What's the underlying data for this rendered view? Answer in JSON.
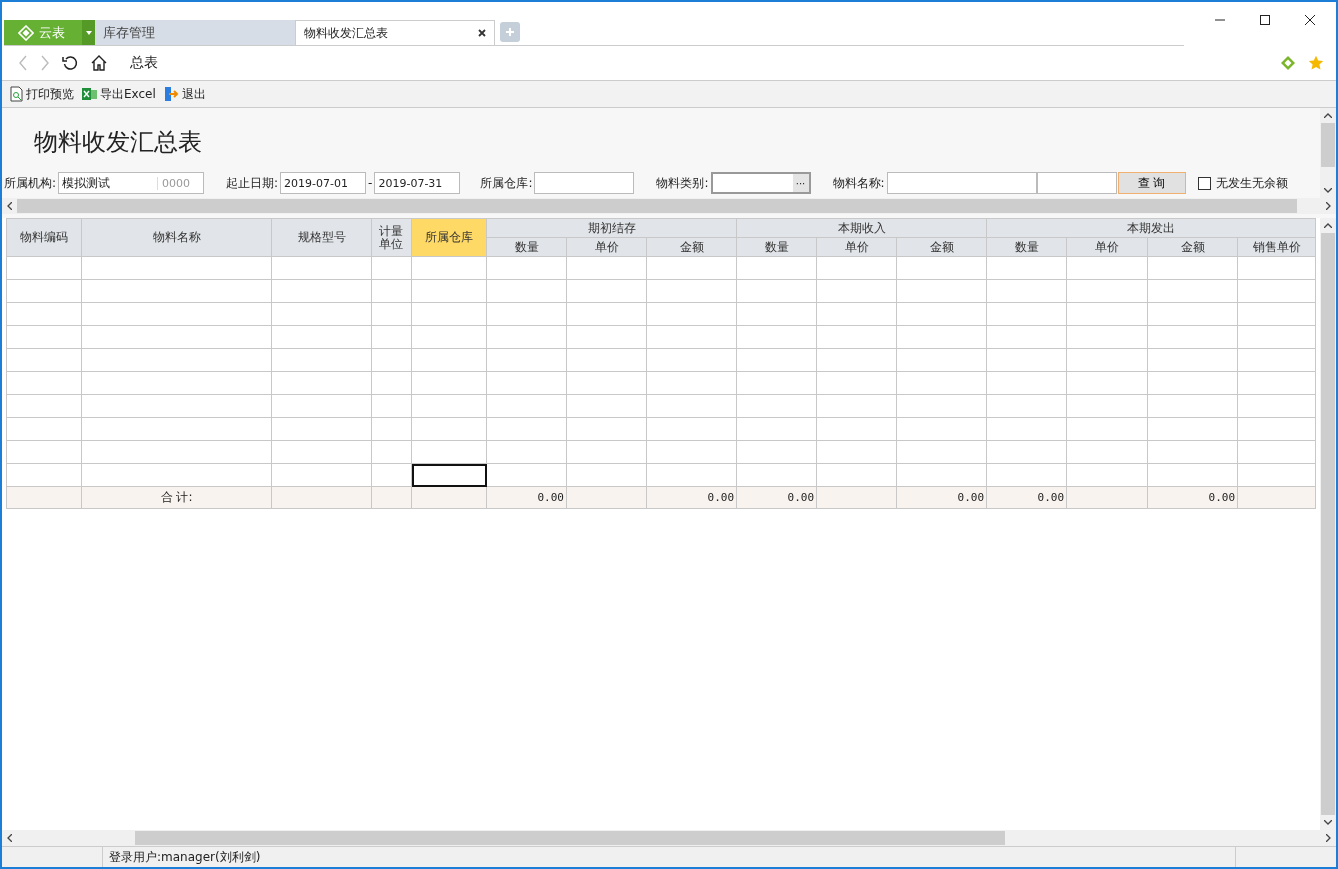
{
  "browser": {
    "brand_tab": "云表",
    "tabs": [
      {
        "label": "库存管理",
        "selected": false
      },
      {
        "label": "物料收发汇总表",
        "selected": true
      }
    ],
    "address": "总表"
  },
  "toolbar": [
    "打印预览",
    "导出Excel",
    "退出"
  ],
  "report_title": "物料收发汇总表",
  "filters": [
    {
      "kind": "text",
      "label": "所属机构:",
      "value": "模拟测试",
      "code": "0000"
    },
    {
      "kind": "range",
      "label": "起止日期:",
      "from": "2019-07-01",
      "separator": "-",
      "to": "2019-07-31"
    },
    {
      "kind": "text",
      "label": "所属仓库:"
    },
    {
      "kind": "picker",
      "label": "物料类别:",
      "button": "···"
    },
    {
      "kind": "double",
      "label": "物料名称:"
    }
  ],
  "query_button": "查  询",
  "checkbox": {
    "label": "无发生无余额",
    "checked": false
  },
  "table": {
    "columns": [
      {
        "label": "物料编码",
        "selected": false
      },
      {
        "label": "物料名称",
        "selected": false
      },
      {
        "label": "规格型号",
        "selected": false
      },
      {
        "label": "计量单位",
        "selected": false
      },
      {
        "label": "所属仓库",
        "selected": true
      },
      {
        "label": "期初结存",
        "children": [
          "数量",
          "单价",
          "金额"
        ]
      },
      {
        "label": "本期收入",
        "children": [
          "数量",
          "单价",
          "金额"
        ]
      },
      {
        "label": "本期发出",
        "children": [
          "数量",
          "单价",
          "金额",
          "销售单价"
        ]
      }
    ],
    "rows": [
      {
        "selected": false
      },
      {
        "selected": false
      },
      {
        "selected": false
      },
      {
        "selected": false
      },
      {
        "selected": false
      },
      {
        "selected": false
      },
      {
        "selected": false
      },
      {
        "selected": false
      },
      {
        "selected": false
      },
      {
        "selected": true
      }
    ],
    "totals": {
      "label": "合  计:",
      "cells": [
        "0.00",
        null,
        "0.00",
        "0.00",
        null,
        "0.00",
        "0.00",
        null,
        "0.00",
        null
      ]
    }
  },
  "status_bar": {
    "user": "登录用户:manager(刘利剑)"
  }
}
